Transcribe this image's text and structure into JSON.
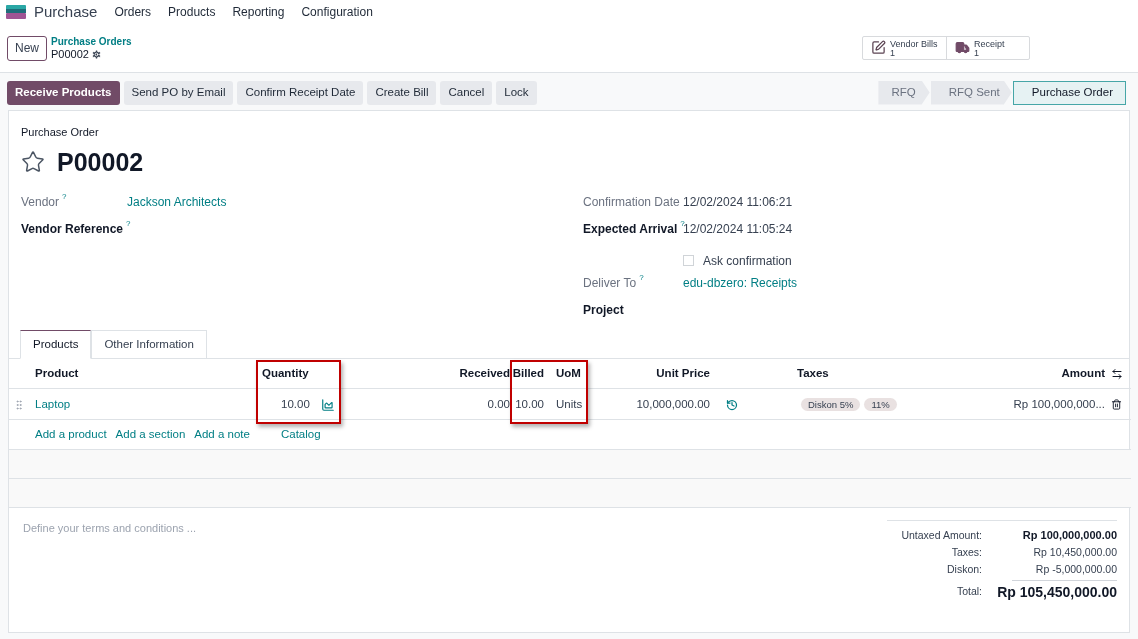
{
  "app": {
    "name": "Purchase",
    "menu": [
      "Orders",
      "Products",
      "Reporting",
      "Configuration"
    ]
  },
  "breadcrumb": {
    "new_button": "New",
    "parent": "Purchase Orders",
    "current": "P00002"
  },
  "smart_buttons": [
    {
      "kind": "bills",
      "label": "Vendor Bills",
      "count": "1"
    },
    {
      "kind": "receipt",
      "label": "Receipt",
      "count": "1"
    }
  ],
  "actions": [
    {
      "label": "Receive Products",
      "primary": true
    },
    {
      "label": "Send PO by Email",
      "primary": false
    },
    {
      "label": "Confirm Receipt Date",
      "primary": false
    },
    {
      "label": "Create Bill",
      "primary": false
    },
    {
      "label": "Cancel",
      "primary": false
    },
    {
      "label": "Lock",
      "primary": false
    }
  ],
  "status_steps": [
    {
      "label": "RFQ",
      "selected": false
    },
    {
      "label": "RFQ Sent",
      "selected": false
    },
    {
      "label": "Purchase Order",
      "selected": true
    }
  ],
  "form": {
    "caption": "Purchase Order",
    "name": "P00002",
    "starred": false,
    "left_fields": [
      {
        "kind": "field",
        "label": "Vendor",
        "help": "?",
        "required": false,
        "value": "Jackson Architects",
        "link": true
      },
      {
        "kind": "field",
        "label": "Vendor Reference",
        "help": "?",
        "required": true
      }
    ],
    "right_fields": [
      {
        "kind": "field",
        "label": "Confirmation Date",
        "required": false,
        "value": "12/02/2024 11:06:21",
        "link": false
      },
      {
        "kind": "field",
        "label": "Expected Arrival",
        "help": "?",
        "required": true,
        "value": "12/02/2024 11:05:24",
        "link": false
      },
      {
        "kind": "checkbox",
        "label": "Ask confirmation",
        "checked": false
      },
      {
        "kind": "field",
        "label": "Deliver To",
        "help": "?",
        "required": false,
        "value": "edu-dbzero: Receipts",
        "link": true
      },
      {
        "kind": "field",
        "label": "Project",
        "required": true
      }
    ]
  },
  "tabs": [
    {
      "label": "Products",
      "selected": true
    },
    {
      "label": "Other Information",
      "selected": false
    }
  ],
  "table": {
    "columns": [
      {
        "label": "Product",
        "highlighted": false
      },
      {
        "label": "Quantity",
        "highlighted": true
      },
      {
        "label": "Received",
        "highlighted": false
      },
      {
        "label": "Billed",
        "highlighted": true
      },
      {
        "label": "UoM",
        "highlighted": true
      },
      {
        "label": "Unit Price",
        "highlighted": false
      },
      {
        "label": "Taxes",
        "highlighted": false
      },
      {
        "label": "Amount",
        "highlighted": false
      }
    ],
    "rows": [
      {
        "product": "Laptop",
        "quantity": "10.00",
        "received": "0.00",
        "billed": "10.00",
        "uom": "Units",
        "unit_price": "10,000,000.00",
        "taxes": [
          "Diskon 5%",
          "11%"
        ],
        "amount": "Rp 100,000,000..."
      }
    ],
    "add_links": [
      "Add a product",
      "Add a section",
      "Add a note",
      "Catalog"
    ]
  },
  "terms": {
    "placeholder": "Define your terms and conditions ..."
  },
  "totals": [
    {
      "label": "Untaxed Amount:",
      "value": "Rp 100,000,000.00",
      "kind": "subtotal"
    },
    {
      "label": "Taxes:",
      "value": "Rp 10,450,000.00",
      "kind": "line"
    },
    {
      "label": "Diskon:",
      "value": "Rp -5,000,000.00",
      "kind": "line"
    },
    {
      "label": "Total:",
      "value": "Rp 105,450,000.00",
      "kind": "total"
    }
  ]
}
